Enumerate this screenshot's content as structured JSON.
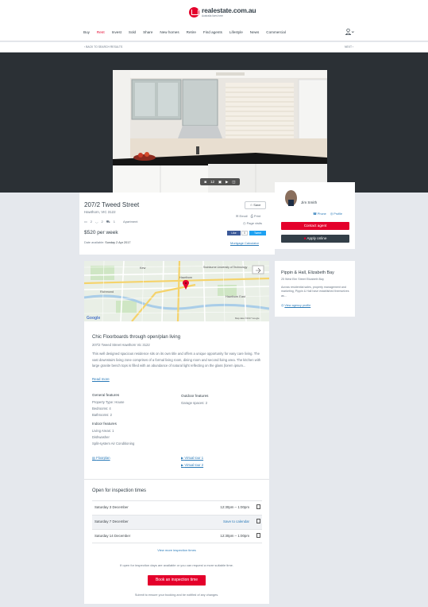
{
  "header": {
    "brand": "realestate.com.au",
    "tagline": "Australia lives here",
    "nav": [
      "Buy",
      "Rent",
      "Invest",
      "Sold",
      "Share",
      "New homes",
      "Retire",
      "Find agents",
      "Lifestyle",
      "News",
      "Commercial"
    ],
    "active_nav": "Rent"
  },
  "breadcrumb": {
    "back": "BACK TO SEARCH RESULTS",
    "next": "NEXT"
  },
  "gallery": {
    "photo_count": "12"
  },
  "listing": {
    "address": "207/2 Tweed Street",
    "suburb": "Hawthorn, VIC 3122",
    "beds": "2",
    "baths": "2",
    "cars": "1",
    "type": "Apartment",
    "price": "$520 per week",
    "available_label": "Date available:",
    "available_value": "Sunday 2 Apr 2017",
    "save": "Save",
    "email": "Email",
    "print": "Print",
    "page_visits": "Page visits",
    "fb_like": "Like",
    "fb_count": "0",
    "tweet": "Tweet",
    "mortgage": "Mortgage Calculator"
  },
  "agent": {
    "name": "Jim Smith",
    "phone": "Phone",
    "profile": "Profile",
    "contact": "Contact agent",
    "apply": "Apply online"
  },
  "agency": {
    "name": "Pippin & Hall, Elizabeth Bay",
    "address": "25 West Elm Street Elizabeth Bay",
    "description": "Across residential sales, property management and marketing, Pippin & Hall have established themselves as...",
    "link": "View agency profile"
  },
  "map": {
    "label": "Swinburne University of Technology",
    "area1": "Hawthorn",
    "area2": "Hawthorn East",
    "area3": "Kew",
    "area4": "Richmond",
    "credit": "Map data ©2017 Google",
    "google": "Google"
  },
  "description": {
    "heading": "Chic Floorboards through open/plan living",
    "address": "207/2 Tweed Street Hawthorn Vic 3122",
    "body": "This well designed spacious residence sits on its own title and offers a unique opportunity for easy care living. The vast downstairs living zone comprises of a formal living room, dining room and second living area. The kitchen with large granite bench tops is filled with an abundance of natural light reflecting on the glass (lorem ipsum...",
    "read_more": "Read more",
    "general_h": "General features",
    "general": [
      "Property Type: House",
      "Bedrooms: 4",
      "Bathrooms: 2"
    ],
    "outdoor_h": "Outdoor features",
    "outdoor": [
      "Garage spaces: 2"
    ],
    "indoor_h": "Indoor features",
    "indoor": [
      "Living Areas: 1",
      "Dishwasher",
      "Split-system Air Conditioning"
    ],
    "floorplan": "Floorplan",
    "tour1": "Virtual tour 1",
    "tour2": "Virtual tour 2"
  },
  "inspection": {
    "heading": "Open for inspection times",
    "rows": [
      {
        "date": "Saturday 3 December",
        "time": "12:30pm – 1:00pm"
      },
      {
        "date": "Saturday 7 December",
        "time": "Save to calendar"
      },
      {
        "date": "Saturday 14 December",
        "time": "12:30pm – 1:00pm"
      }
    ],
    "more": "View more inspection times",
    "note": "If open for inspection days are available or you can request a more suitable time.",
    "book": "Book an inspection time",
    "note2": "Submit to ensure your booking and be notified of any changes."
  },
  "colors": {
    "brand": "#e4002b",
    "dark": "#333f48",
    "link": "#2b7bb9",
    "background": "#e5e8ed"
  }
}
